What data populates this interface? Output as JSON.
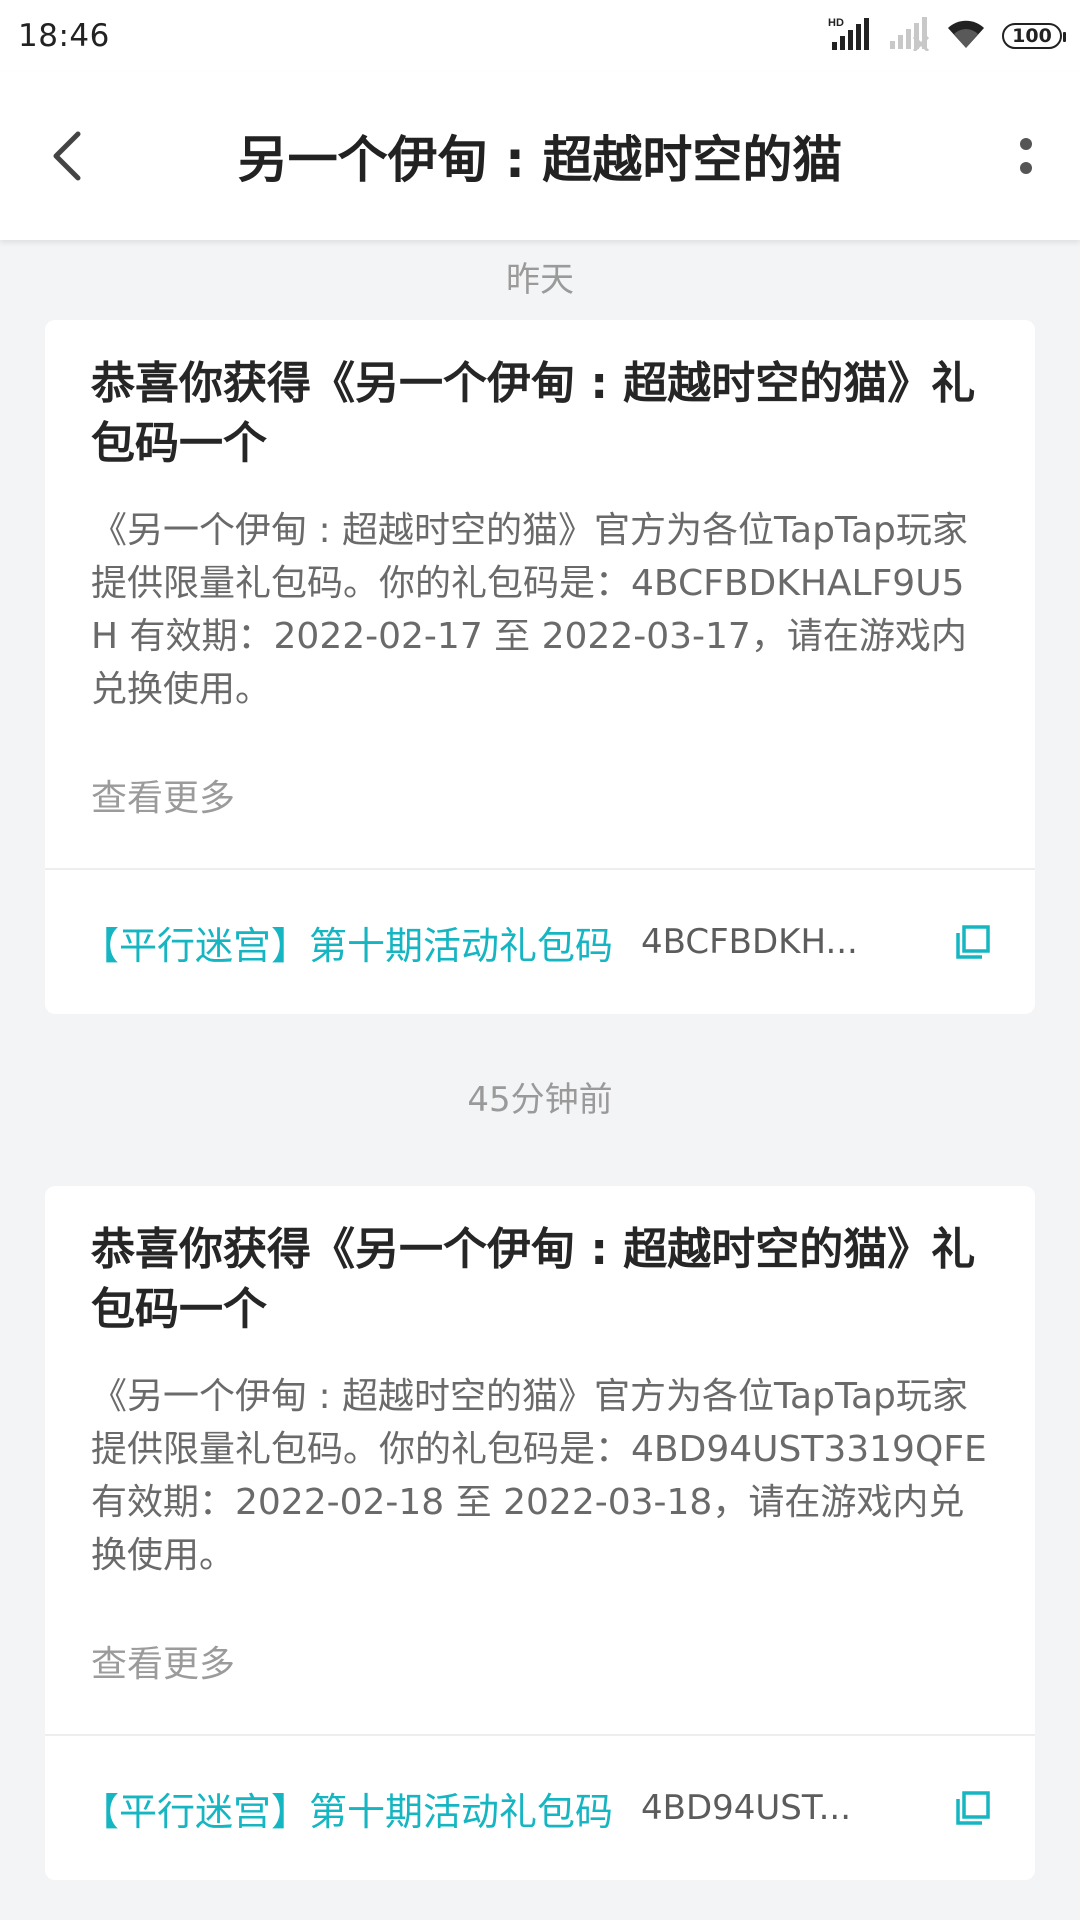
{
  "status_bar": {
    "time": "18:46",
    "battery": "100",
    "icons": [
      "hd-signal-icon",
      "no-signal-icon",
      "wifi-icon",
      "battery-icon"
    ]
  },
  "app_bar": {
    "title": "另一个伊甸 : 超越时空的猫",
    "back_icon": "chevron-left-icon",
    "more_icon": "more-vertical-icon"
  },
  "messages": [
    {
      "date": "昨天",
      "title": "恭喜你获得《另一个伊甸 : 超越时空的猫》礼包码一个",
      "description": "《另一个伊甸 : 超越时空的猫》官方为各位TapTap玩家提供限量礼包码。你的礼包码是：4BCFBDKHALF9U5H 有效期：2022-02-17 至 2022-03-17，请在游戏内兑换使用。",
      "see_more": "查看更多",
      "gift_name": "【平行迷宫】第十期活动礼包码",
      "gift_code": "4BCFBDKH...",
      "copy_icon": "copy-icon"
    },
    {
      "date": "45分钟前",
      "title": "恭喜你获得《另一个伊甸 : 超越时空的猫》礼包码一个",
      "description": "《另一个伊甸 : 超越时空的猫》官方为各位TapTap玩家提供限量礼包码。你的礼包码是：4BD94UST3319QFE 有效期：2022-02-18 至 2022-03-18，请在游戏内兑换使用。",
      "see_more": "查看更多",
      "gift_name": "【平行迷宫】第十期活动礼包码",
      "gift_code": "4BD94UST...",
      "copy_icon": "copy-icon"
    }
  ],
  "colors": {
    "accent": "#15b5c2",
    "background": "#f3f4f6",
    "card": "#ffffff"
  }
}
